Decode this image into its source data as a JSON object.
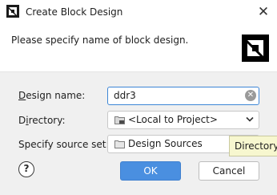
{
  "window": {
    "title": "Create Block Design",
    "close_glyph": "✕"
  },
  "header": {
    "message": "Please specify name of block design."
  },
  "form": {
    "design_name": {
      "label": "Design name:",
      "mnemonic": "D",
      "rest": "esign name:",
      "value": "ddr3"
    },
    "directory": {
      "label": "Directory:",
      "mnemonic": "i",
      "pre": "D",
      "rest": "rectory:",
      "value": "<Local to Project>"
    },
    "source_set": {
      "label": "Specify source set:",
      "value": "Design Sources"
    }
  },
  "buttons": {
    "help": "?",
    "ok": "OK",
    "cancel": "Cancel"
  },
  "tooltip": {
    "text": "Directory"
  },
  "colors": {
    "accent": "#4a8fe0",
    "focus": "#3d86d6",
    "tooltip_bg": "#f7f7cf"
  },
  "icons": [
    "app-logo-icon",
    "close-icon",
    "brand-logo-icon",
    "clear-icon",
    "folder-drive-icon",
    "folder-icon",
    "chevron-down-icon",
    "help-icon"
  ]
}
